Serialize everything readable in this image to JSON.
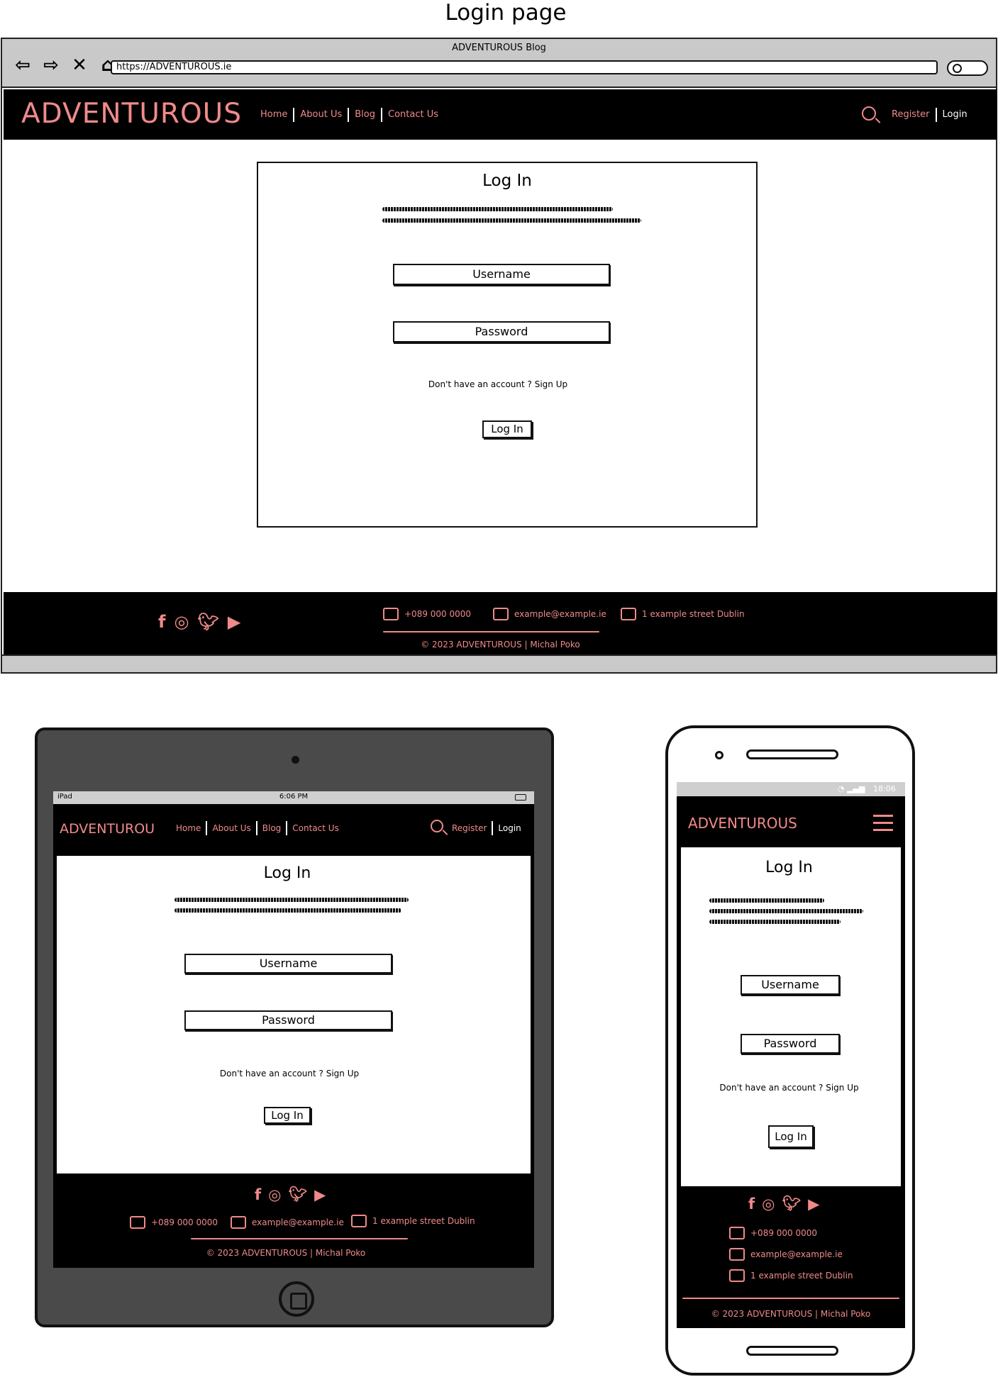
{
  "page_title": "Login page",
  "colors": {
    "accent": "#f08a8a",
    "nav_bg": "#000000",
    "chrome_bg": "#c9c9c9",
    "device_bg": "#4a4a4a"
  },
  "browser": {
    "window_title": "ADVENTUROUS Blog",
    "url": "https://ADVENTUROUS.ie",
    "nav_icons": [
      "back-icon",
      "forward-icon",
      "close-icon",
      "home-icon"
    ]
  },
  "site": {
    "brand": "ADVENTUROUS",
    "brand_tablet": "ADVENTUROU",
    "nav": {
      "home": "Home",
      "about": "About Us",
      "blog": "Blog",
      "contact": "Contact Us"
    },
    "auth": {
      "register": "Register",
      "login": "Login"
    }
  },
  "login": {
    "title": "Log In",
    "username_placeholder": "Username",
    "password_placeholder": "Password",
    "signup_text": "Don't have an account ? Sign Up",
    "submit_label": "Log In"
  },
  "footer": {
    "social_icons": [
      "facebook-icon",
      "instagram-icon",
      "twitter-icon",
      "youtube-icon"
    ],
    "phone": "+089 000 0000",
    "email": "example@example.ie",
    "address": "1 example street Dublin",
    "copyright": "© 2023 ADVENTUROUS | Michal Poko"
  },
  "tablet": {
    "status_left": "iPad",
    "status_time": "6:06 PM"
  },
  "phone": {
    "status_time": "18:06"
  }
}
